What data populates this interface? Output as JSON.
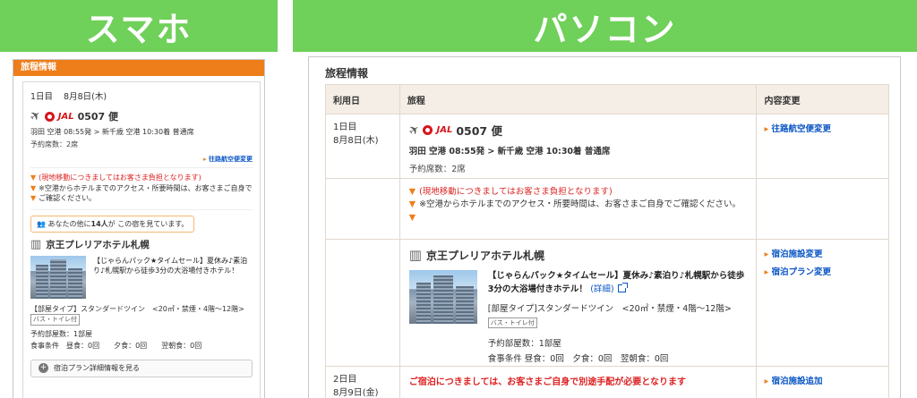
{
  "banners": {
    "sp": "スマホ",
    "pc": "パソコン"
  },
  "common": {
    "section_title": "旅程情報",
    "day1_label": "1日目",
    "day1_date": "8月8日(木)",
    "flight_number": "0507 便",
    "airline": "JAL",
    "route": "羽田 空港 08:55発 > 新千歳 空港 10:30着 普通席",
    "seats": "予約席数：2席",
    "change_flight": "往路航空便変更",
    "note1": "(現地移動につきましてはお客さま負担となります)",
    "note2": "※空港からホテルまでのアクセス・所要時間は、お客さまご自身でご確認ください。",
    "hotel_name": "京王プレリアホテル札幌",
    "pack_title": "【じゃらんパック★タイムセール】夏休み♪素泊り♪札幌駅から徒歩3分の大浴場付きホテル！",
    "detail_link": "(詳細)",
    "room_type": "[部屋タイプ]スタンダードツイン　<20㎡・禁煙・4階～12階>",
    "bath_tag": "バス・トイレ付",
    "rooms": "予約部屋数：1部屋",
    "meals": "食事条件 昼食：0回　夕食：0回　翌朝食：0回"
  },
  "sp": {
    "seats": "予約席数：2席",
    "viewers_prefix": "あなたの他に",
    "viewers_count": "14人",
    "viewers_suffix": "が この宿を見ています。",
    "room_type": "【部屋タイプ】スタンダードツイン　<20㎡・禁煙・4階～12階>",
    "meals": "食事条件　昼食：0回　　夕食：0回　　翌朝食：0回",
    "plan_button": "宿泊プラン詳細情報を見る"
  },
  "pc": {
    "headers": [
      "利用日",
      "旅程",
      "内容変更"
    ],
    "change_hotel": "宿泊施設変更",
    "change_plan": "宿泊プラン変更",
    "day2_label": "2日目",
    "day2_date": "8月9日(金)",
    "day2_notice": "ご宿泊につきましては、お客さまご自身で別途手配が必要となります",
    "add_hotel": "宿泊施設追加"
  }
}
